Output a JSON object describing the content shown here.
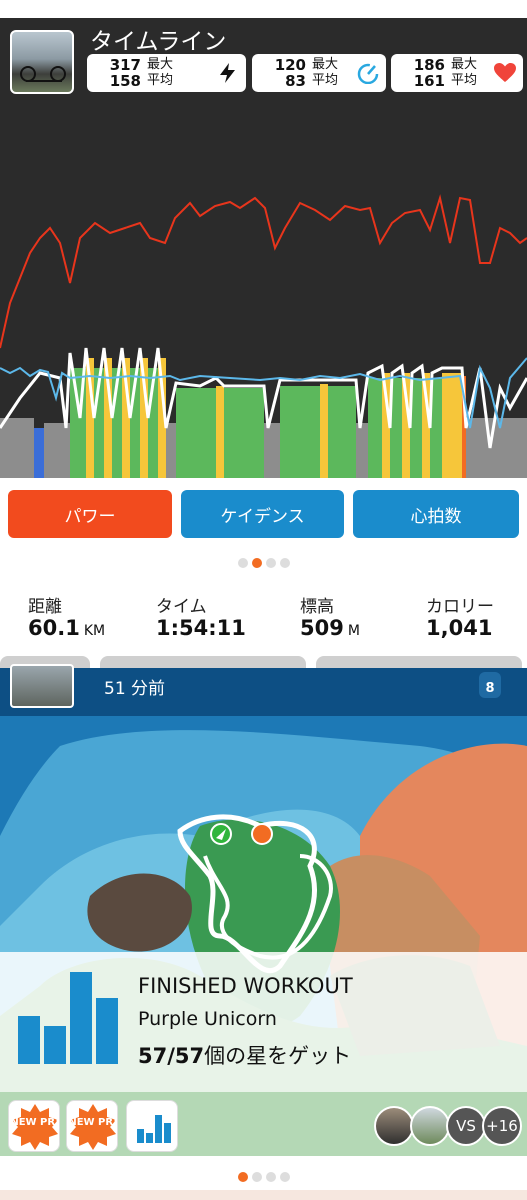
{
  "timeline": {
    "title": "タイムライン",
    "power": {
      "max": "317",
      "avg": "158",
      "max_label": "最大",
      "avg_label": "平均",
      "icon": "lightning-icon"
    },
    "cadence": {
      "max": "120",
      "avg": "83",
      "max_label": "最大",
      "avg_label": "平均",
      "icon": "cadence-gauge-icon"
    },
    "heart": {
      "max": "186",
      "avg": "161",
      "max_label": "最大",
      "avg_label": "平均",
      "icon": "heart-icon"
    }
  },
  "toggles": [
    {
      "label": "パワー",
      "color": "#f24b1e"
    },
    {
      "label": "ケイデンス",
      "color": "#1a8ccc"
    },
    {
      "label": "心拍数",
      "color": "#1a8ccc"
    }
  ],
  "summary": [
    {
      "label": "距離",
      "value": "60.1",
      "unit": "KM"
    },
    {
      "label": "タイム",
      "value": "1:54:11",
      "unit": ""
    },
    {
      "label": "標高",
      "value": "509",
      "unit": "M"
    },
    {
      "label": "カロリー",
      "value": "1,041",
      "unit": ""
    }
  ],
  "activity": {
    "time_ago": "51 分前",
    "ride_on_count": "8"
  },
  "workout": {
    "status": "FINISHED WORKOUT",
    "name": "Purple Unicorn",
    "stars_count": "57/57",
    "stars_text": "個の星をゲット"
  },
  "badges": {
    "new_pr": "NEW PR!",
    "vs": "VS",
    "plus": "+16"
  },
  "colors": {
    "accent": "#f26c22",
    "blue": "#1a8ccc",
    "dark": "#2b2b2b",
    "navy": "#0d4f84"
  }
}
